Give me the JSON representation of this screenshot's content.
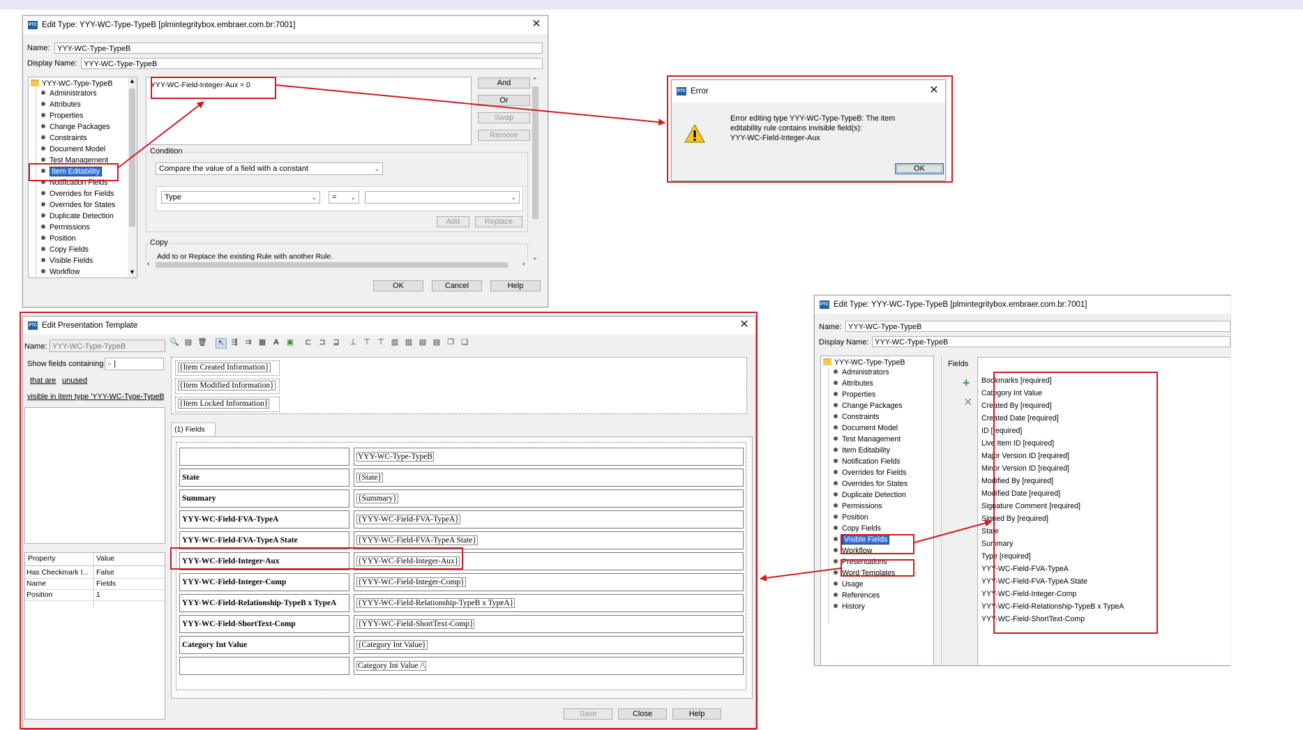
{
  "edit_type_top": {
    "title": "Edit Type: YYY-WC-Type-TypeB [plmintegritybox.embraer.com.br:7001]",
    "name_label": "Name:",
    "name_value": "YYY-WC-Type-TypeB",
    "display_name_label": "Display Name:",
    "display_name_value": "YYY-WC-Type-TypeB",
    "tree_root": "YYY-WC-Type-TypeB",
    "tree_items": [
      "Administrators",
      "Attributes",
      "Properties",
      "Change Packages",
      "Constraints",
      "Document Model",
      "Test Management",
      "Item Editability",
      "Notification Fields",
      "Overrides for Fields",
      "Overrides for States",
      "Duplicate Detection",
      "Permissions",
      "Position",
      "Copy Fields",
      "Visible Fields",
      "Workflow"
    ],
    "rule_text": "YYY-WC-Field-Integer-Aux = 0",
    "and_label": "And",
    "or_label": "Or",
    "swap_label": "Swap",
    "remove_label": "Remove",
    "condition_label": "Condition",
    "condition_combo": "Compare the value of a field with a constant",
    "field_combo": "Type",
    "op_combo": "=",
    "add_label": "Add",
    "replace_label": "Replace",
    "copy_label": "Copy",
    "copy_text": "Add to or Replace the existing Rule with another Rule.",
    "ok_label": "OK",
    "cancel_label": "Cancel",
    "help_label": "Help"
  },
  "error_dialog": {
    "title": "Error",
    "message_line1": "Error editing type YYY-WC-Type-TypeB: The item",
    "message_line2": "editability rule contains invisible field(s):",
    "message_line3": "YYY-WC-Field-Integer-Aux",
    "ok_label": "OK"
  },
  "presentation": {
    "title": "Edit Presentation Template",
    "name_label": "Name:",
    "name_value": "YYY-WC-Type-TypeB",
    "show_fields_label": "Show fields containing",
    "filter_that_are": "that are",
    "filter_unused": "unused",
    "visible_label": "visible in item type 'YYY-WC-Type-TypeB'",
    "prop_header_property": "Property",
    "prop_header_value": "Value",
    "props": [
      {
        "k": "Has Checkmark I...",
        "v": "False"
      },
      {
        "k": "Name",
        "v": "Fields"
      },
      {
        "k": "Position",
        "v": "1"
      }
    ],
    "header_items": [
      "{Item Created Information}",
      "{Item Modified Information}",
      "{Item Locked Information}"
    ],
    "tab_label": "(1) Fields",
    "rows": [
      {
        "l": "",
        "r": "YYY-WC-Type-TypeB"
      },
      {
        "l": "State",
        "r": "{State}"
      },
      {
        "l": "Summary",
        "r": "{Summary}"
      },
      {
        "l": "YYY-WC-Field-FVA-TypeA",
        "r": "{YYY-WC-Field-FVA-TypeA}"
      },
      {
        "l": "YYY-WC-Field-FVA-TypeA State",
        "r": "{YYY-WC-Field-FVA-TypeA State}"
      },
      {
        "l": "YYY-WC-Field-Integer-Aux",
        "r": "{YYY-WC-Field-Integer-Aux}"
      },
      {
        "l": "YYY-WC-Field-Integer-Comp",
        "r": "{YYY-WC-Field-Integer-Comp}"
      },
      {
        "l": "YYY-WC-Field-Relationship-TypeB x TypeA",
        "r": "{YYY-WC-Field-Relationship-TypeB x TypeA}"
      },
      {
        "l": "YYY-WC-Field-ShortText-Comp",
        "r": "{YYY-WC-Field-ShortText-Comp}"
      },
      {
        "l": "Category Int Value",
        "r": "{Category Int Value}"
      },
      {
        "l": "",
        "r": "Category Int Value /\\"
      }
    ],
    "save_label": "Save",
    "close_label": "Close",
    "help_label": "Help"
  },
  "edit_type_right": {
    "title": "Edit Type: YYY-WC-Type-TypeB [plmintegritybox.embraer.com.br:7001]",
    "name_label": "Name:",
    "name_value": "YYY-WC-Type-TypeB",
    "display_name_label": "Display Name:",
    "display_name_value": "YYY-WC-Type-TypeB",
    "tree_root": "YYY-WC-Type-TypeB",
    "tree_items": [
      "Administrators",
      "Attributes",
      "Properties",
      "Change Packages",
      "Constraints",
      "Document Model",
      "Test Management",
      "Item Editability",
      "Notification Fields",
      "Overrides for Fields",
      "Overrides for States",
      "Duplicate Detection",
      "Permissions",
      "Position",
      "Copy Fields",
      "Visible Fields",
      "Workflow",
      "Presentations",
      "Word Templates",
      "Usage",
      "References",
      "History"
    ],
    "fields_label": "Fields",
    "visible_fields": [
      "Bookmarks [required]",
      "Category Int Value",
      "Created By [required]",
      "Created Date [required]",
      "ID [required]",
      "Live Item ID [required]",
      "Major Version ID [required]",
      "Minor Version ID [required]",
      "Modified By [required]",
      "Modified Date [required]",
      "Signature Comment [required]",
      "Signed By [required]",
      "State",
      "Summary",
      "Type [required]",
      "YYY-WC-Field-FVA-TypeA",
      "YYY-WC-Field-FVA-TypeA State",
      "YYY-WC-Field-Integer-Comp",
      "YYY-WC-Field-Relationship-TypeB x TypeA",
      "YYY-WC-Field-ShortText-Comp"
    ]
  },
  "colors": {
    "annotation_red": "#d0191e",
    "selection_blue": "#2f6fd6"
  }
}
